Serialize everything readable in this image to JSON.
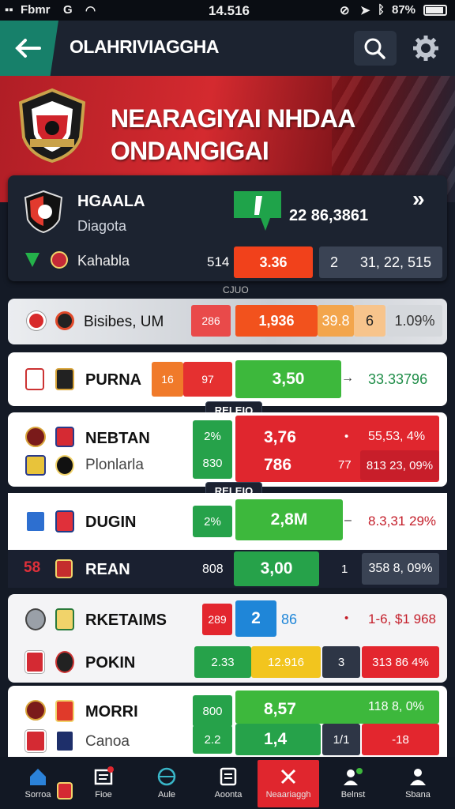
{
  "status": {
    "carrier": "Fbmr",
    "carrier_icon": "G",
    "time": "14.516",
    "battery": "87%"
  },
  "header": {
    "title": "OLAHRIVIAGGHA"
  },
  "banner": {
    "line1": "NEARAGIYAI NHDAA",
    "line2": "ONDANGIGAI"
  },
  "featured": {
    "team": "HGAALA",
    "subtitle": "Diagota",
    "value": "22 86,3861",
    "arrow": "»",
    "league": "Kahabla",
    "odds_label": "514",
    "odds_red": "3.36",
    "odds_dark_prefix": "2",
    "odds_dark": "31, 22, 515",
    "under_label": "CJUO"
  },
  "summary_row": {
    "name": "Bisibes, UM",
    "a": "286",
    "b": "1,936",
    "c": "39.8",
    "d": "6",
    "e": "1.09%"
  },
  "rows": [
    {
      "name": "PURNA",
      "o1a": "16",
      "o1b": "97",
      "main": "3,50",
      "arrow": "→",
      "right": "33.33796"
    },
    {
      "name": "NEBTAN",
      "sub": "Plonlarla",
      "o1": "2%",
      "o2": "830",
      "main": "3,76",
      "main2": "786",
      "arrow": "•",
      "right": "55,53, 4%",
      "right2": "813 23, 09%",
      "mid2": "77",
      "tag": "RELEIO"
    },
    {
      "name": "DUGIN",
      "o1": "2%",
      "main": "2,8M",
      "arrow": "–",
      "right": "8.3,31 29%",
      "tag": "RELEIO"
    },
    {
      "name": "REAN",
      "logo_text": "58",
      "o1": "808",
      "main": "3,00",
      "mid": "1",
      "right": "358 8, 09%"
    },
    {
      "name": "RKETAIMS",
      "o1": "289",
      "blue": "2",
      "o2": "86",
      "arrow": "•",
      "right": "1-6, $1 968"
    },
    {
      "name": "POKIN",
      "o1": "2.33",
      "o2": "12.916",
      "mid": "3",
      "right": "313 86 4%"
    },
    {
      "name": "MORRI",
      "sub": "Canoa",
      "o1": "800",
      "o1b": "2.2",
      "main": "8,57",
      "main2": "1,4",
      "right": "118 8, 0%",
      "mid": "1/1",
      "right2": "-18"
    }
  ],
  "nav": [
    {
      "label": "Sorroa",
      "icon": "home-icon"
    },
    {
      "label": "Fioe",
      "icon": "ticket-icon"
    },
    {
      "label": "Aule",
      "icon": "globe-icon"
    },
    {
      "label": "Aoonta",
      "icon": "list-icon"
    },
    {
      "label": "Neaariaggh",
      "icon": "cross-icon"
    },
    {
      "label": "Belnst",
      "icon": "people-icon"
    },
    {
      "label": "Sbana",
      "icon": "person-icon"
    }
  ]
}
